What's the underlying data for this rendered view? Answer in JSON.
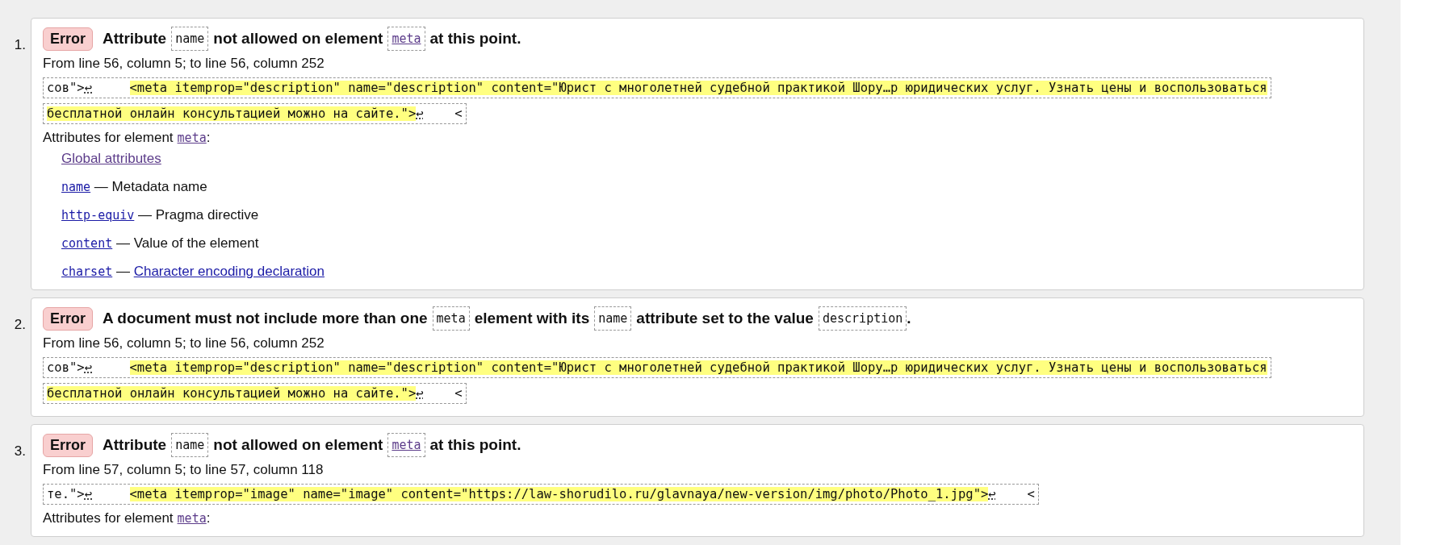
{
  "messages": [
    {
      "number": "1.",
      "badge": "Error",
      "title": [
        {
          "kind": "text",
          "text": "Attribute"
        },
        {
          "kind": "code",
          "text": "name"
        },
        {
          "kind": "text",
          "text": "not allowed on element"
        },
        {
          "kind": "code_link",
          "text": "meta",
          "visited": true
        },
        {
          "kind": "text",
          "text": "at this point."
        }
      ],
      "location": "From line 56, column 5; to line 56, column 252",
      "extract": [
        {
          "kind": "context",
          "text": "сов\">"
        },
        {
          "kind": "linebreak",
          "text": "↩"
        },
        {
          "kind": "highlight",
          "text": "<meta itemprop=\"description\" name=\"description\" content=\"Юрист с многолетней судебной практикой Шору…р юридических услуг. Узнать цены и воспользоваться"
        },
        {
          "kind": "highlight_continued",
          "text": "бесплатной онлайн консультацией можно на сайте.\">"
        },
        {
          "kind": "linebreak",
          "text": "↩"
        },
        {
          "kind": "context",
          "text": "<"
        }
      ],
      "attributes": {
        "heading": [
          {
            "kind": "text",
            "text": "Attributes for element"
          },
          {
            "kind": "code_link",
            "text": "meta",
            "visited": true
          },
          {
            "kind": "text",
            "text": ":"
          }
        ],
        "items": [
          {
            "kind": "link",
            "text": "Global attributes",
            "visited": true
          },
          {
            "kind": "term",
            "term": "name",
            "visited": false,
            "description": "— Metadata name"
          },
          {
            "kind": "term",
            "term": "http-equiv",
            "visited": false,
            "description": "— Pragma directive"
          },
          {
            "kind": "term",
            "term": "content",
            "visited": false,
            "description": "— Value of the element"
          },
          {
            "kind": "term_link",
            "term": "charset",
            "visited": false,
            "separator": "—",
            "link": "Character encoding declaration"
          }
        ]
      }
    },
    {
      "number": "2.",
      "badge": "Error",
      "title": [
        {
          "kind": "text",
          "text": "A document must not include more than one"
        },
        {
          "kind": "code",
          "text": "meta"
        },
        {
          "kind": "text",
          "text": "element with its"
        },
        {
          "kind": "code",
          "text": "name"
        },
        {
          "kind": "text",
          "text": "attribute set to the value"
        },
        {
          "kind": "code",
          "text": "description"
        },
        {
          "kind": "end",
          "text": "."
        }
      ],
      "location": "From line 56, column 5; to line 56, column 252",
      "extract": [
        {
          "kind": "context",
          "text": "сов\">"
        },
        {
          "kind": "linebreak",
          "text": "↩"
        },
        {
          "kind": "highlight",
          "text": "<meta itemprop=\"description\" name=\"description\" content=\"Юрист с многолетней судебной практикой Шору…р юридических услуг. Узнать цены и воспользоваться"
        },
        {
          "kind": "highlight_continued",
          "text": "бесплатной онлайн консультацией можно на сайте.\">"
        },
        {
          "kind": "linebreak",
          "text": "↩"
        },
        {
          "kind": "context",
          "text": "<"
        }
      ]
    },
    {
      "number": "3.",
      "badge": "Error",
      "title": [
        {
          "kind": "text",
          "text": "Attribute"
        },
        {
          "kind": "code",
          "text": "name"
        },
        {
          "kind": "text",
          "text": "not allowed on element"
        },
        {
          "kind": "code_link",
          "text": "meta",
          "visited": true
        },
        {
          "kind": "text",
          "text": "at this point."
        }
      ],
      "location": "From line 57, column 5; to line 57, column 118",
      "extract": [
        {
          "kind": "context",
          "text": "те.\">"
        },
        {
          "kind": "linebreak",
          "text": "↩"
        },
        {
          "kind": "highlight",
          "text": "<meta itemprop=\"image\" name=\"image\" content=\"https://law-shorudilo.ru/glavnaya/new-version/img/photo/Photo_1.jpg\">"
        },
        {
          "kind": "linebreak",
          "text": "↩"
        },
        {
          "kind": "context",
          "text": "<"
        }
      ],
      "attributes": {
        "heading": [
          {
            "kind": "text",
            "text": "Attributes for element"
          },
          {
            "kind": "code_link",
            "text": "meta",
            "visited": true
          },
          {
            "kind": "text",
            "text": ":"
          }
        ]
      }
    }
  ]
}
